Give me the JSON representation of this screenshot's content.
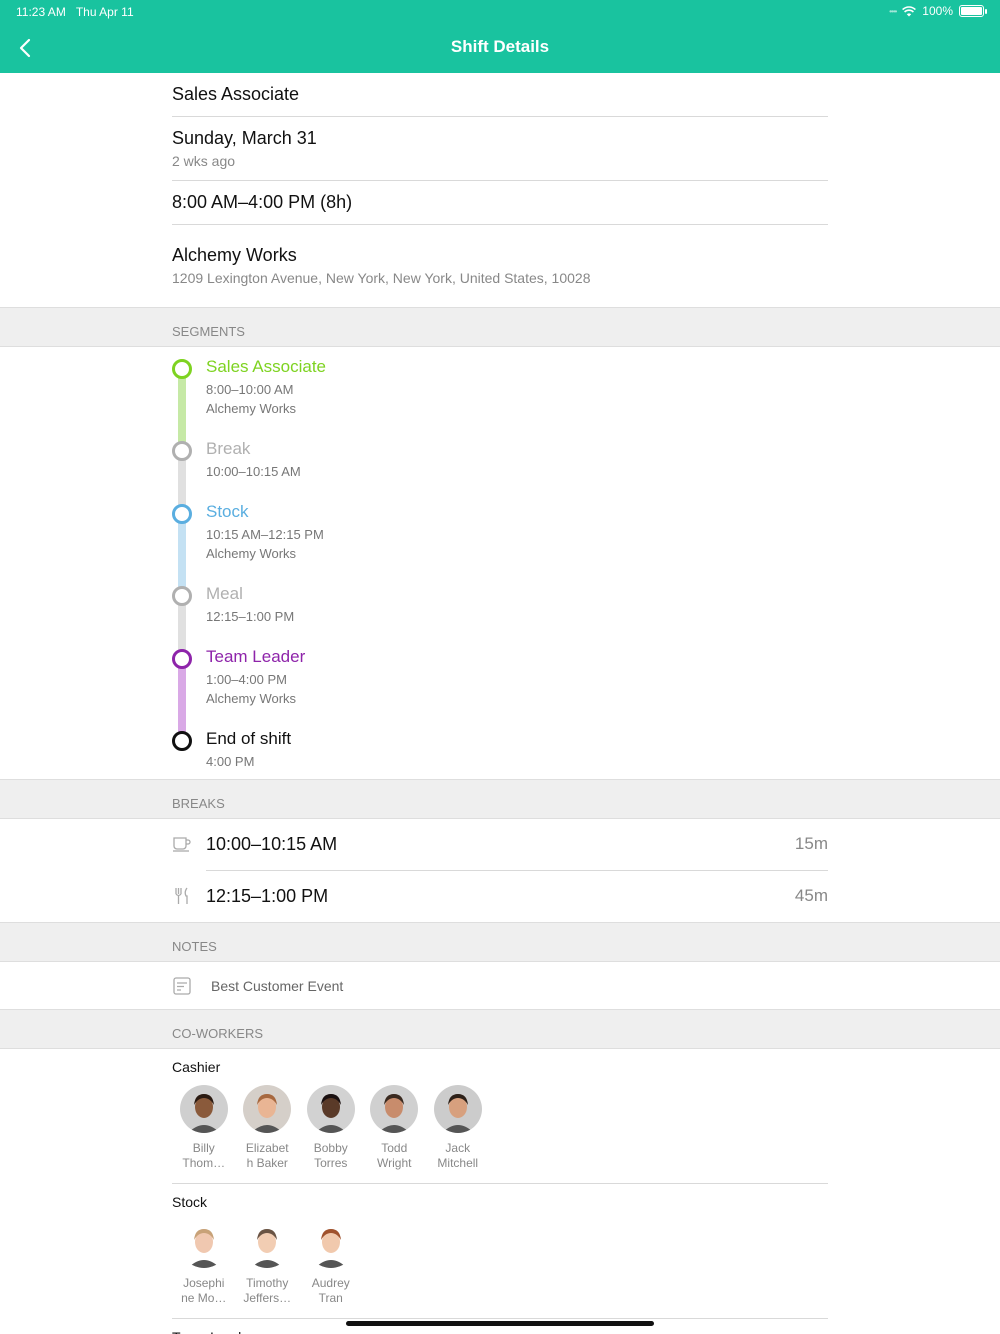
{
  "status": {
    "time": "11:23 AM",
    "date": "Thu Apr 11",
    "battery": "100%"
  },
  "nav": {
    "title": "Shift Details"
  },
  "shift": {
    "position": "Sales Associate",
    "date": "Sunday, March 31",
    "relative": "2 wks ago",
    "hours": "8:00 AM–4:00 PM (8h)",
    "location": "Alchemy Works",
    "address": "1209 Lexington Avenue, New York, New York, United States, 10028"
  },
  "segments_header": "SEGMENTS",
  "segments": [
    {
      "title": "Sales Associate",
      "time": "8:00–10:00 AM",
      "location": "Alchemy Works",
      "color": "#7ed321",
      "line": "#c6e9a6"
    },
    {
      "title": "Break",
      "time": "10:00–10:15 AM",
      "color": "#b0b0b0",
      "line": "#e0e0e0"
    },
    {
      "title": "Stock",
      "time": "10:15 AM–12:15 PM",
      "location": "Alchemy Works",
      "color": "#5aaee0",
      "line": "#c4e1f3"
    },
    {
      "title": "Meal",
      "time": "12:15–1:00 PM",
      "color": "#b0b0b0",
      "line": "#e0e0e0"
    },
    {
      "title": "Team Leader",
      "time": "1:00–4:00 PM",
      "location": "Alchemy Works",
      "color": "#8e24aa",
      "line": "#d9a9e6"
    },
    {
      "title": "End of shift",
      "time": "4:00 PM",
      "color": "#111111"
    }
  ],
  "breaks_header": "BREAKS",
  "breaks": [
    {
      "icon": "coffee-cup-icon",
      "time": "10:00–10:15 AM",
      "duration": "15m"
    },
    {
      "icon": "fork-knife-icon",
      "time": "12:15–1:00 PM",
      "duration": "45m"
    }
  ],
  "notes_header": "NOTES",
  "notes": {
    "icon": "note-icon",
    "text": "Best Customer Event"
  },
  "coworkers_header": "CO-WORKERS",
  "coworker_groups": [
    {
      "title": "Cashier",
      "people": [
        {
          "name1": "Billy",
          "name2": "Thom…",
          "skin": "#8a5a3b",
          "hair": "#2a1a12",
          "bg": "#cfcfcf"
        },
        {
          "name1": "Elizabet",
          "name2": "h Baker",
          "skin": "#e9b594",
          "hair": "#a7683f",
          "bg": "#d5cfc9"
        },
        {
          "name1": "Bobby",
          "name2": "Torres",
          "skin": "#5a3a28",
          "hair": "#1a1010",
          "bg": "#d2d2d2"
        },
        {
          "name1": "Todd",
          "name2": "Wright",
          "skin": "#c88c6c",
          "hair": "#3a2a20",
          "bg": "#d0d0d0"
        },
        {
          "name1": "Jack",
          "name2": "Mitchell",
          "skin": "#d7a07e",
          "hair": "#2c2018",
          "bg": "#cccccc"
        }
      ]
    },
    {
      "title": "Stock",
      "people": [
        {
          "name1": "Josephi",
          "name2": "ne Mo…",
          "skin": "#f0c8b0",
          "hair": "#c8a278",
          "bg": "#ffffff"
        },
        {
          "name1": "Timothy",
          "name2": "Jeffers…",
          "skin": "#f2cdb3",
          "hair": "#6a5444",
          "bg": "#ffffff"
        },
        {
          "name1": "Audrey",
          "name2": "Tran",
          "skin": "#f1c9ad",
          "hair": "#a0522d",
          "bg": "#ffffff"
        }
      ]
    },
    {
      "title": "Team Leader",
      "people": []
    }
  ]
}
